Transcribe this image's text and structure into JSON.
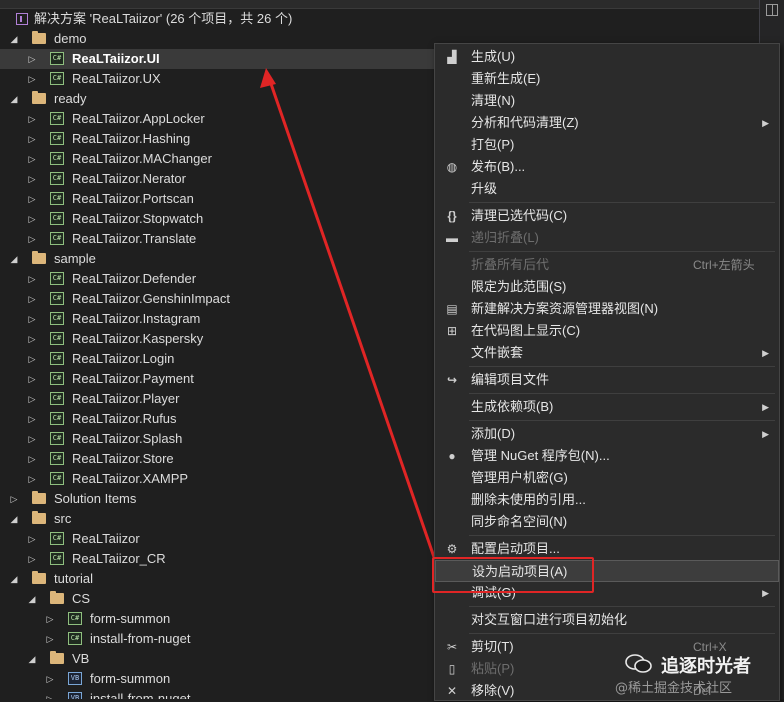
{
  "solution": {
    "label": "解决方案 'ReaLTaiizor' (26 个项目，共 26 个)"
  },
  "tree": [
    {
      "label": "demo",
      "type": "folder",
      "depth": 0,
      "expanded": true
    },
    {
      "label": "ReaLTaiizor.UI",
      "type": "cs",
      "depth": 1,
      "expanded": false,
      "selected": true
    },
    {
      "label": "ReaLTaiizor.UX",
      "type": "cs",
      "depth": 1,
      "expanded": false
    },
    {
      "label": "ready",
      "type": "folder",
      "depth": 0,
      "expanded": true
    },
    {
      "label": "ReaLTaiizor.AppLocker",
      "type": "cs",
      "depth": 1,
      "expanded": false
    },
    {
      "label": "ReaLTaiizor.Hashing",
      "type": "cs",
      "depth": 1,
      "expanded": false
    },
    {
      "label": "ReaLTaiizor.MAChanger",
      "type": "cs",
      "depth": 1,
      "expanded": false
    },
    {
      "label": "ReaLTaiizor.Nerator",
      "type": "cs",
      "depth": 1,
      "expanded": false
    },
    {
      "label": "ReaLTaiizor.Portscan",
      "type": "cs",
      "depth": 1,
      "expanded": false
    },
    {
      "label": "ReaLTaiizor.Stopwatch",
      "type": "cs",
      "depth": 1,
      "expanded": false
    },
    {
      "label": "ReaLTaiizor.Translate",
      "type": "cs",
      "depth": 1,
      "expanded": false
    },
    {
      "label": "sample",
      "type": "folder",
      "depth": 0,
      "expanded": true
    },
    {
      "label": "ReaLTaiizor.Defender",
      "type": "cs",
      "depth": 1,
      "expanded": false
    },
    {
      "label": "ReaLTaiizor.GenshinImpact",
      "type": "cs",
      "depth": 1,
      "expanded": false
    },
    {
      "label": "ReaLTaiizor.Instagram",
      "type": "cs",
      "depth": 1,
      "expanded": false
    },
    {
      "label": "ReaLTaiizor.Kaspersky",
      "type": "cs",
      "depth": 1,
      "expanded": false
    },
    {
      "label": "ReaLTaiizor.Login",
      "type": "cs",
      "depth": 1,
      "expanded": false
    },
    {
      "label": "ReaLTaiizor.Payment",
      "type": "cs",
      "depth": 1,
      "expanded": false
    },
    {
      "label": "ReaLTaiizor.Player",
      "type": "cs",
      "depth": 1,
      "expanded": false
    },
    {
      "label": "ReaLTaiizor.Rufus",
      "type": "cs",
      "depth": 1,
      "expanded": false
    },
    {
      "label": "ReaLTaiizor.Splash",
      "type": "cs",
      "depth": 1,
      "expanded": false
    },
    {
      "label": "ReaLTaiizor.Store",
      "type": "cs",
      "depth": 1,
      "expanded": false
    },
    {
      "label": "ReaLTaiizor.XAMPP",
      "type": "cs",
      "depth": 1,
      "expanded": false
    },
    {
      "label": "Solution Items",
      "type": "folder",
      "depth": 0,
      "expanded": false
    },
    {
      "label": "src",
      "type": "folder",
      "depth": 0,
      "expanded": true
    },
    {
      "label": "ReaLTaiizor",
      "type": "cs",
      "depth": 1,
      "expanded": false
    },
    {
      "label": "ReaLTaiizor_CR",
      "type": "cs",
      "depth": 1,
      "expanded": false
    },
    {
      "label": "tutorial",
      "type": "folder",
      "depth": 0,
      "expanded": true
    },
    {
      "label": "CS",
      "type": "folder",
      "depth": 1,
      "expanded": true
    },
    {
      "label": "form-summon",
      "type": "cs",
      "depth": 2,
      "expanded": false
    },
    {
      "label": "install-from-nuget",
      "type": "cs",
      "depth": 2,
      "expanded": false
    },
    {
      "label": "VB",
      "type": "folder",
      "depth": 1,
      "expanded": true
    },
    {
      "label": "form-summon",
      "type": "vb",
      "depth": 2,
      "expanded": false
    },
    {
      "label": "install-from-nuget",
      "type": "vb",
      "depth": 2,
      "expanded": false
    }
  ],
  "context_menu": [
    {
      "label": "生成(U)",
      "icon": "build-icon"
    },
    {
      "label": "重新生成(E)"
    },
    {
      "label": "清理(N)"
    },
    {
      "label": "分析和代码清理(Z)",
      "submenu": true
    },
    {
      "label": "打包(P)"
    },
    {
      "label": "发布(B)...",
      "icon": "globe-icon"
    },
    {
      "label": "升级"
    },
    {
      "sep": true
    },
    {
      "label": "清理已选代码(C)",
      "icon": "braces-icon"
    },
    {
      "label": "递归折叠(L)",
      "icon": "collapse-icon",
      "disabled": true
    },
    {
      "sep": true
    },
    {
      "label": "折叠所有后代",
      "shortcut": "Ctrl+左箭头",
      "disabled": true
    },
    {
      "label": "限定为此范围(S)"
    },
    {
      "label": "新建解决方案资源管理器视图(N)",
      "icon": "new-view-icon"
    },
    {
      "label": "在代码图上显示(C)",
      "icon": "code-map-icon"
    },
    {
      "label": "文件嵌套",
      "submenu": true
    },
    {
      "sep": true
    },
    {
      "label": "编辑项目文件",
      "icon": "refresh-icon"
    },
    {
      "sep": true
    },
    {
      "label": "生成依赖项(B)",
      "submenu": true
    },
    {
      "sep": true
    },
    {
      "label": "添加(D)",
      "submenu": true
    },
    {
      "label": "管理 NuGet 程序包(N)...",
      "icon": "nuget-icon"
    },
    {
      "label": "管理用户机密(G)"
    },
    {
      "label": "删除未使用的引用..."
    },
    {
      "label": "同步命名空间(N)"
    },
    {
      "sep": true
    },
    {
      "label": "配置启动项目...",
      "icon": "gear-icon"
    },
    {
      "label": "设为启动项目(A)",
      "highlighted": true
    },
    {
      "label": "调试(G)",
      "submenu": true
    },
    {
      "sep": true
    },
    {
      "label": "对交互窗口进行项目初始化"
    },
    {
      "sep": true
    },
    {
      "label": "剪切(T)",
      "shortcut": "Ctrl+X",
      "icon": "cut-icon"
    },
    {
      "label": "粘贴(P)",
      "icon": "paste-icon",
      "disabled": true
    },
    {
      "label": "移除(V)",
      "shortcut": "Del",
      "icon": "remove-icon"
    }
  ],
  "icons": {
    "build-icon": "▟",
    "globe-icon": "◍",
    "braces-icon": "{}",
    "collapse-icon": "▬",
    "new-view-icon": "▤",
    "code-map-icon": "⊞",
    "refresh-icon": "↪",
    "nuget-icon": "●",
    "gear-icon": "⚙",
    "cut-icon": "✂",
    "paste-icon": "▯",
    "remove-icon": "✕"
  },
  "watermark": {
    "name": "追逐时光者",
    "site": "@稀土掘金技术社区"
  },
  "colors": {
    "accent": "#e02525",
    "folder": "#dcb67a",
    "background": "#1f1f1f"
  }
}
